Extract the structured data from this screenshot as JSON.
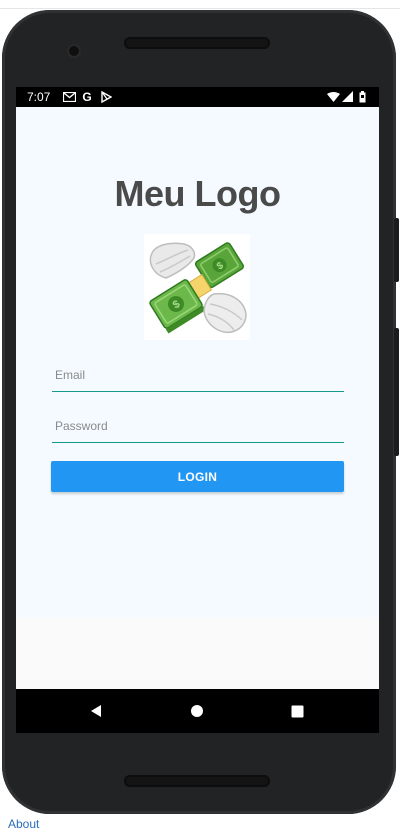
{
  "status_bar": {
    "time": "7:07",
    "left_icons": [
      "gmail-icon",
      "google-icon",
      "play-store-icon"
    ],
    "right_icons": [
      "wifi-icon",
      "signal-icon",
      "battery-icon"
    ]
  },
  "app": {
    "title": "Meu Logo",
    "image": "flying-money-icon",
    "email_placeholder": "Email",
    "password_placeholder": "Password",
    "login_label": "LOGIN",
    "accent_color": "#2196f3",
    "underline_color": "#139a8a"
  },
  "nav_bar": {
    "buttons": [
      "back-icon",
      "home-icon",
      "recents-icon"
    ]
  },
  "page": {
    "about_link": "About"
  }
}
